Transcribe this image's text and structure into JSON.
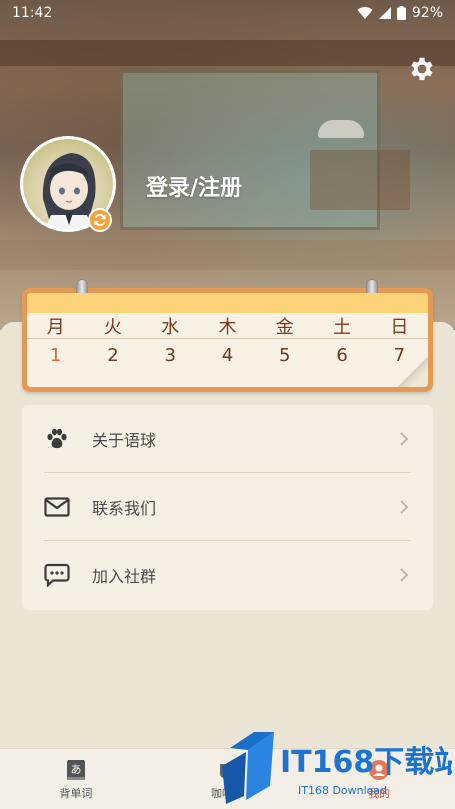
{
  "status_bar": {
    "time": "11:42",
    "battery": "92%"
  },
  "header": {
    "login_label": "登录/注册"
  },
  "calendar": {
    "weekdays": [
      "月",
      "火",
      "水",
      "木",
      "金",
      "土",
      "日"
    ],
    "dates": [
      "1",
      "2",
      "3",
      "4",
      "5",
      "6",
      "7"
    ]
  },
  "menu": {
    "items": [
      {
        "label": "关于语球",
        "icon": "paw-icon"
      },
      {
        "label": "联系我们",
        "icon": "mail-icon"
      },
      {
        "label": "加入社群",
        "icon": "chat-icon"
      }
    ]
  },
  "bottom_nav": {
    "items": [
      {
        "label": "背单词",
        "icon": "kana-book-icon"
      },
      {
        "label": "咖啡厅",
        "icon": "coffee-icon"
      },
      {
        "label": "我的",
        "icon": "profile-icon"
      }
    ]
  },
  "watermark": {
    "text": "IT168下载站",
    "subtext": "IT168 Download"
  },
  "colors": {
    "accent": "#e49a55",
    "calendar_header": "#fdd477",
    "active_nav": "#d44a3a",
    "refresh_badge": "#f3a33a"
  }
}
